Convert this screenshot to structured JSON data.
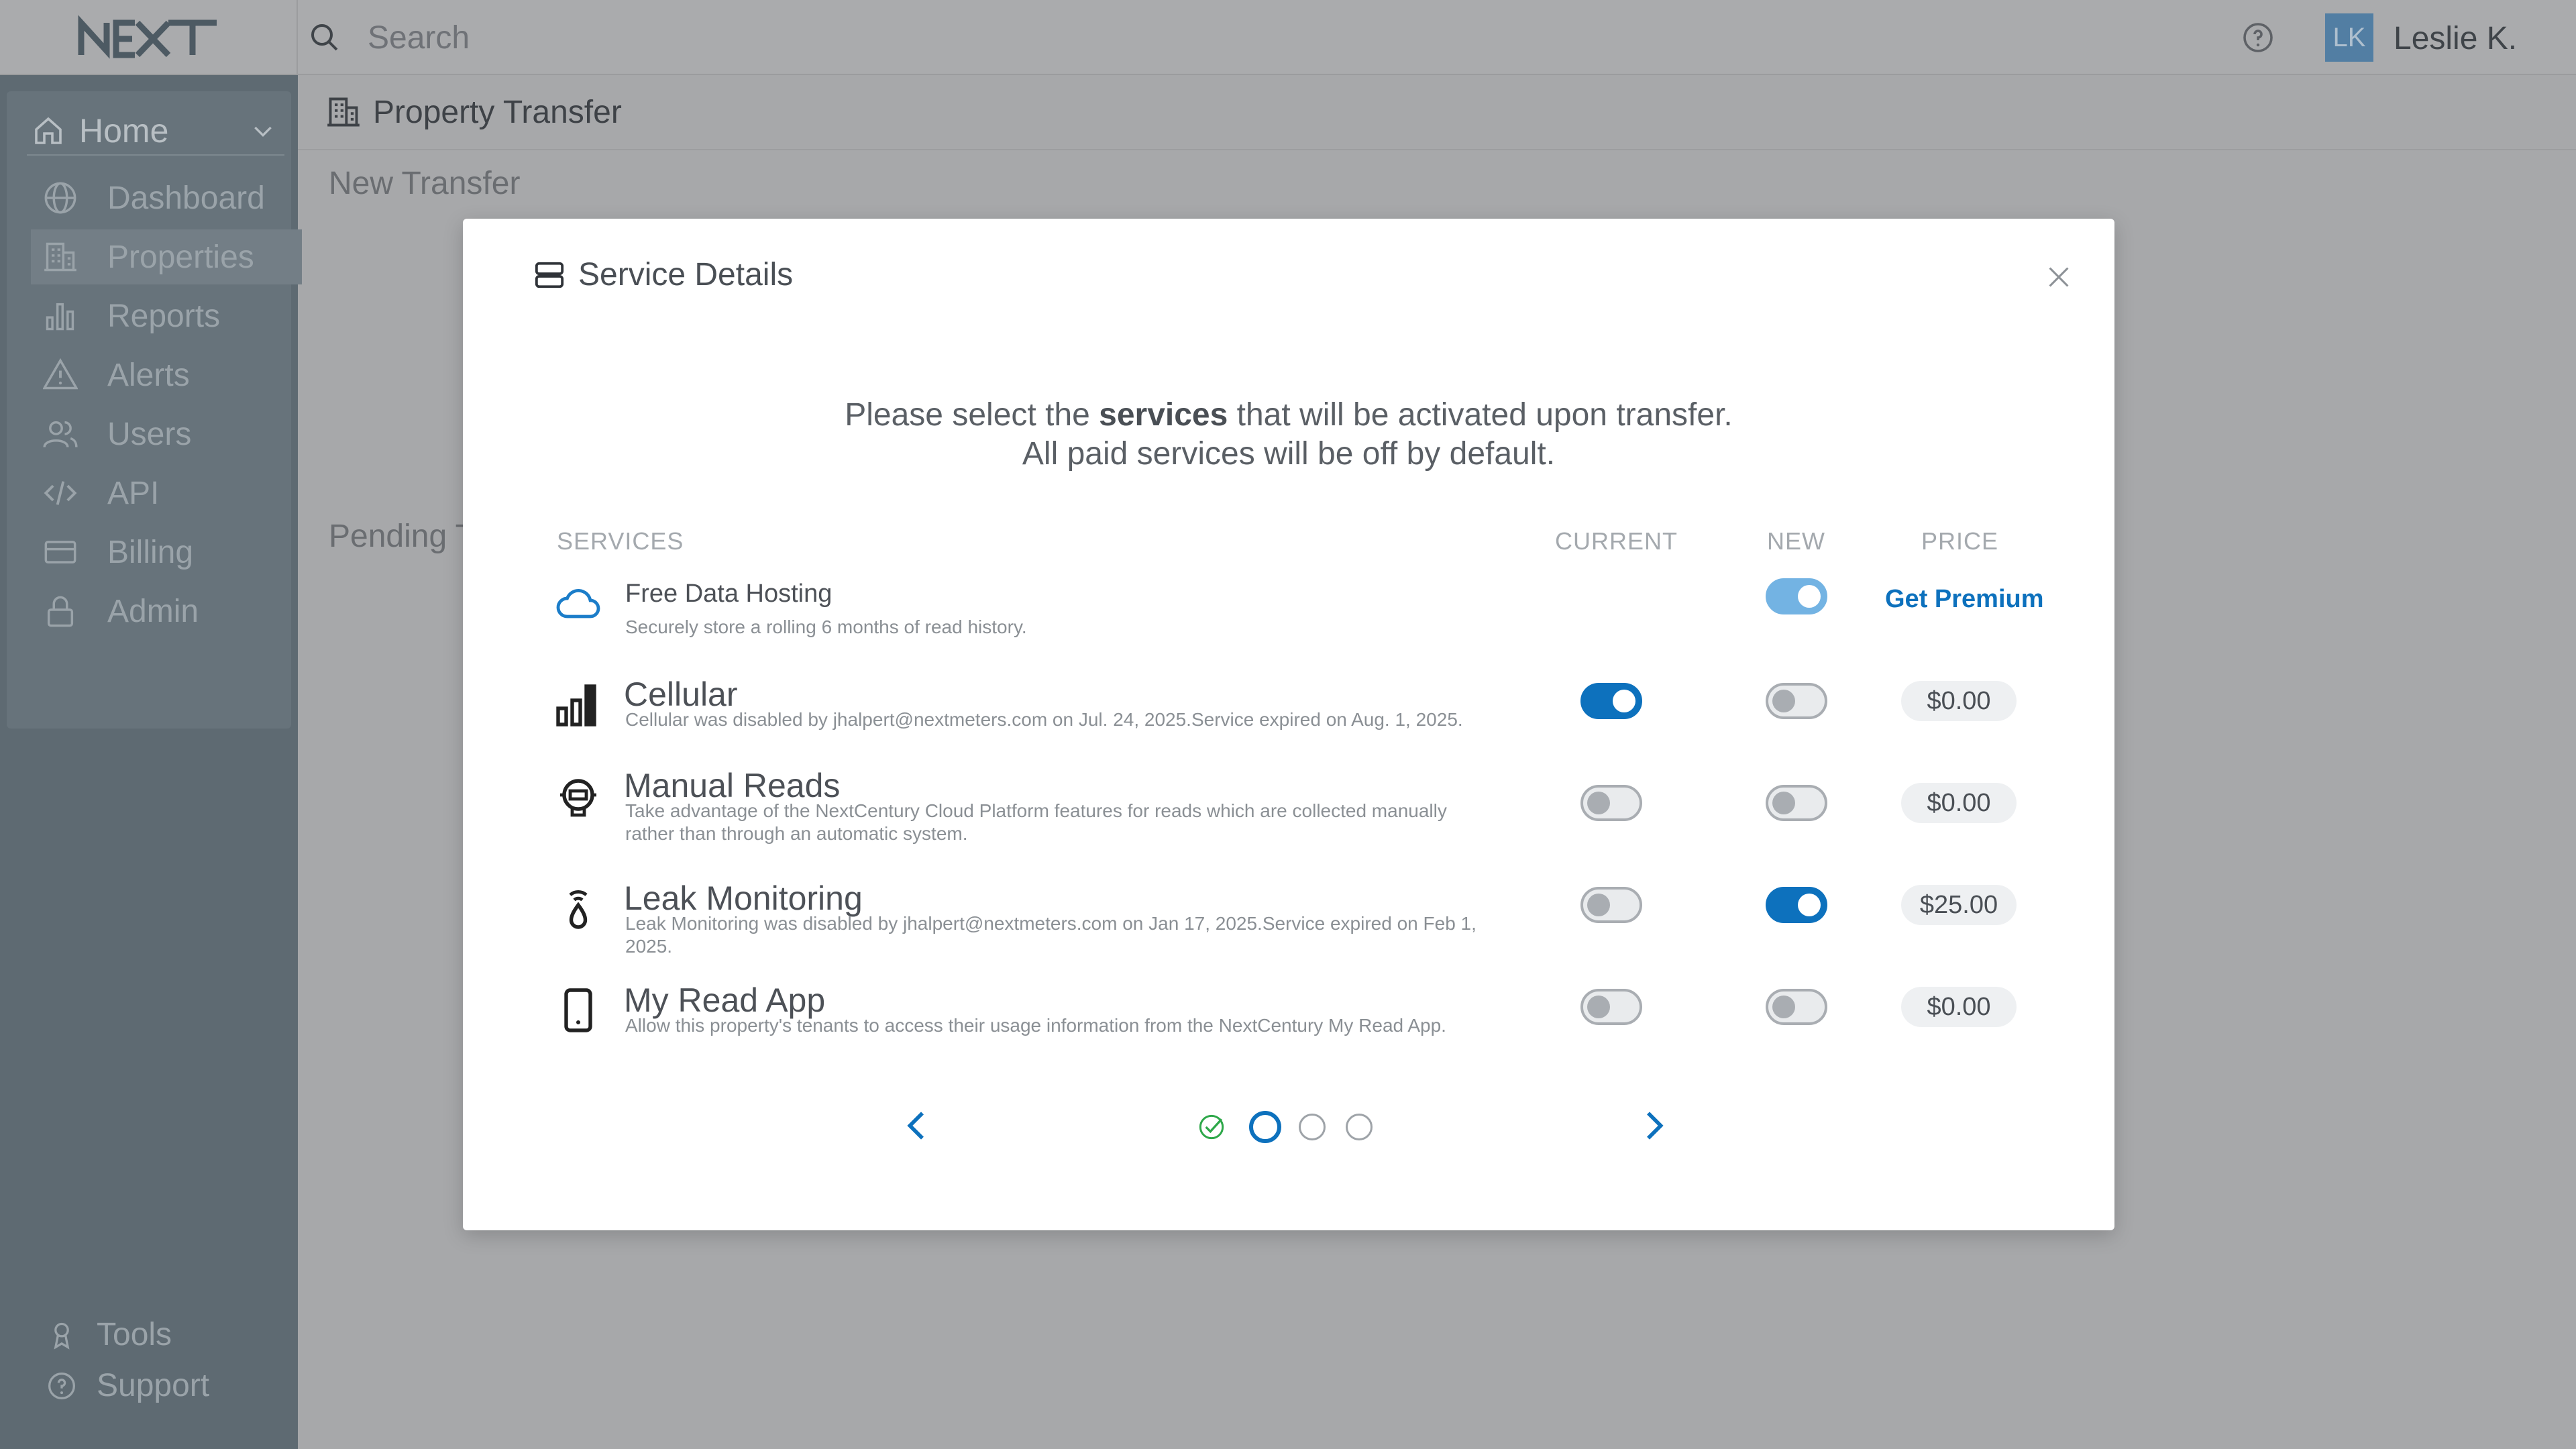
{
  "app": {
    "logo_text": "NEXT"
  },
  "topbar": {
    "search_placeholder": "Search",
    "avatar_initials": "LK",
    "user_name": "Leslie K."
  },
  "sidebar": {
    "section": "Home",
    "items": [
      {
        "label": "Dashboard",
        "icon": "globe-icon"
      },
      {
        "label": "Properties",
        "icon": "building-icon",
        "active": true
      },
      {
        "label": "Reports",
        "icon": "bar-chart-icon"
      },
      {
        "label": "Alerts",
        "icon": "warning-icon"
      },
      {
        "label": "Users",
        "icon": "users-icon"
      },
      {
        "label": "API",
        "icon": "code-icon"
      },
      {
        "label": "Billing",
        "icon": "credit-card-icon"
      },
      {
        "label": "Admin",
        "icon": "lock-icon"
      }
    ],
    "bottom": [
      {
        "label": "Tools",
        "icon": "tools-icon"
      },
      {
        "label": "Support",
        "icon": "help-icon"
      }
    ]
  },
  "page": {
    "title": "Property Transfer",
    "section1": "New Transfer",
    "section2": "Pending Transfers"
  },
  "modal": {
    "title": "Service Details",
    "intro_pre": "Please select the ",
    "intro_bold": "services",
    "intro_post": " that will be activated upon transfer.",
    "intro_line2": "All paid services will be off by default.",
    "columns": {
      "services": "SERVICES",
      "current": "CURRENT",
      "new": "NEW",
      "price": "PRICE"
    },
    "services": [
      {
        "name": "Free Data Hosting",
        "desc": "Securely store a rolling 6 months of read history.",
        "icon": "cloud-icon",
        "current": null,
        "new": true,
        "price": "Get Premium"
      },
      {
        "name": "Cellular",
        "desc": "Cellular was disabled by jhalpert@nextmeters.com on Jul. 24, 2025.Service expired on Aug. 1, 2025.",
        "icon": "signal-bars-icon",
        "current": true,
        "new": false,
        "price": "$0.00"
      },
      {
        "name": "Manual Reads",
        "desc": "Take advantage of the NextCentury Cloud Platform features for reads which are collected manually rather than through an automatic system.",
        "icon": "meter-reader-icon",
        "current": false,
        "new": false,
        "price": "$0.00"
      },
      {
        "name": "Leak Monitoring",
        "desc": "Leak Monitoring was disabled by jhalpert@nextmeters.com on Jan 17, 2025.Service expired on Feb 1, 2025.",
        "icon": "water-drop-signal-icon",
        "current": false,
        "new": true,
        "price": "$25.00"
      },
      {
        "name": "My Read App",
        "desc": "Allow this property's tenants to access their usage information from the NextCentury My Read App.",
        "icon": "mobile-phone-icon",
        "current": false,
        "new": false,
        "price": "$0.00"
      }
    ],
    "pager": {
      "steps": [
        "complete",
        "current",
        "upcoming",
        "upcoming"
      ]
    },
    "colors": {
      "accent": "#0d71bd",
      "success": "#2ea84a"
    }
  }
}
